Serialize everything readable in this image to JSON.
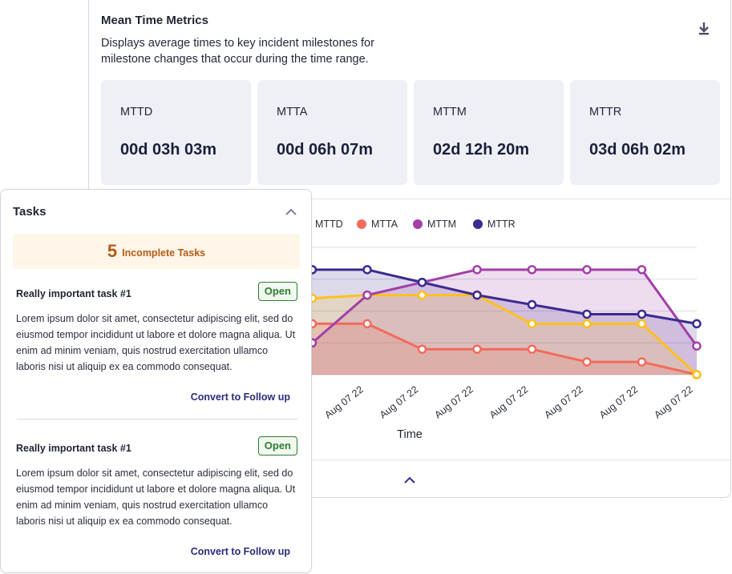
{
  "metrics": {
    "title": "Mean Time Metrics",
    "description": "Displays average times to key incident milestones for milestone changes that occur during the time range.",
    "download_icon": "download-icon",
    "tiles": [
      {
        "label": "MTTD",
        "value": "00d 03h 03m"
      },
      {
        "label": "MTTA",
        "value": "00d 06h 07m"
      },
      {
        "label": "MTTM",
        "value": "02d 12h 20m"
      },
      {
        "label": "MTTR",
        "value": "03d 06h 02m"
      }
    ],
    "collapse_icon": "chevron-up-icon"
  },
  "chart_data": {
    "type": "area",
    "xlabel": "Time",
    "ylabel": "",
    "categories": [
      "Aug 07 22",
      "Aug 07 22",
      "Aug 07 22",
      "Aug 07 22",
      "Aug 07 22",
      "Aug 07 22",
      "Aug 07 22",
      "Aug 07 22",
      "Aug 07 22"
    ],
    "x": [
      0,
      1,
      2,
      3,
      4,
      5,
      6,
      7,
      8
    ],
    "ylim": [
      0,
      4
    ],
    "grid": true,
    "legend_position": "top",
    "series": [
      {
        "name": "MTTD",
        "color": "#ffc01d",
        "values": [
          null,
          2.4,
          2.5,
          2.5,
          2.5,
          1.6,
          1.6,
          1.6,
          0
        ]
      },
      {
        "name": "MTTA",
        "color": "#f26b5b",
        "values": [
          null,
          1.6,
          1.6,
          0.8,
          0.8,
          0.8,
          0.4,
          0.4,
          0
        ]
      },
      {
        "name": "MTTM",
        "color": "#a23fa8",
        "values": [
          null,
          1.0,
          2.5,
          2.9,
          3.3,
          3.3,
          3.3,
          3.3,
          0.9
        ]
      },
      {
        "name": "MTTR",
        "color": "#3b2a8f",
        "values": [
          null,
          3.3,
          3.3,
          2.9,
          2.5,
          2.2,
          1.9,
          1.9,
          1.6
        ]
      }
    ]
  },
  "tasks": {
    "title": "Tasks",
    "collapse_icon": "chevron-up-icon",
    "incomplete_count": "5",
    "incomplete_label": "Incomplete Tasks",
    "items": [
      {
        "title": "Really important task #1",
        "status": "Open",
        "body": "Lorem ipsum dolor sit amet, consectetur adipiscing elit, sed do eiusmod tempor incididunt ut labore et dolore magna aliqua. Ut enim ad minim veniam, quis nostrud exercitation ullamco laboris nisi ut aliquip ex ea commodo consequat.",
        "action": "Convert to Follow up"
      },
      {
        "title": "Really important task #1",
        "status": "Open",
        "body": "Lorem ipsum dolor sit amet, consectetur adipiscing elit, sed do eiusmod tempor incididunt ut labore et dolore magna aliqua. Ut enim ad minim veniam, quis nostrud exercitation ullamco laboris nisi ut aliquip ex ea commodo consequat.",
        "action": "Convert to Follow up"
      }
    ]
  }
}
